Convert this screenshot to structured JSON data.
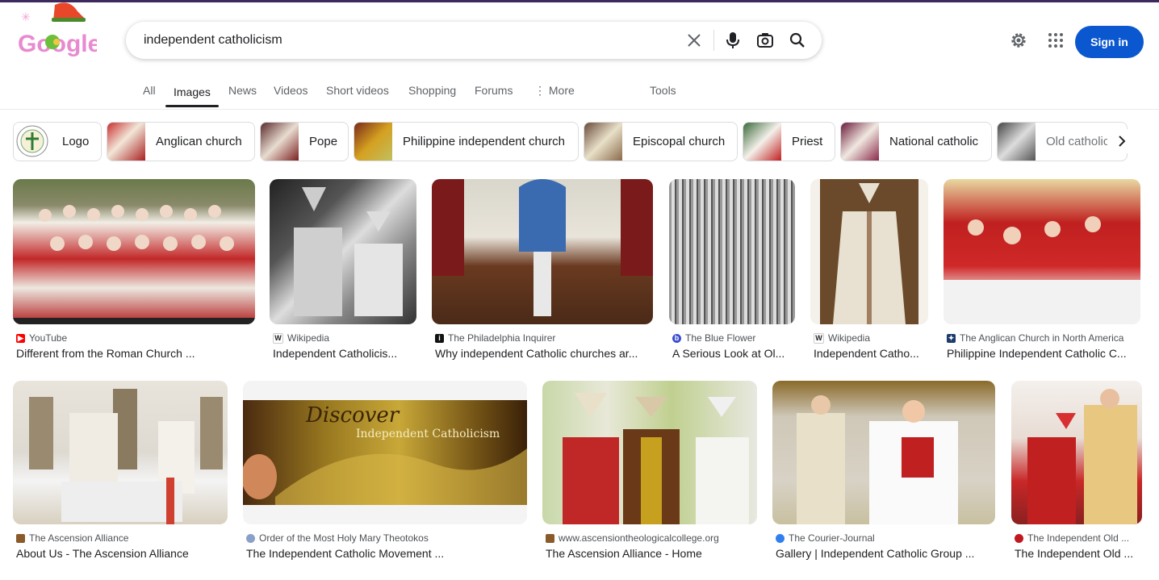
{
  "logo": {
    "text": "Google"
  },
  "search": {
    "query": "independent catholicism"
  },
  "header": {
    "signin_label": "Sign in"
  },
  "tabs": [
    {
      "label": "All"
    },
    {
      "label": "Images"
    },
    {
      "label": "News"
    },
    {
      "label": "Videos"
    },
    {
      "label": "Short videos"
    },
    {
      "label": "Shopping"
    },
    {
      "label": "Forums"
    },
    {
      "label": "More"
    }
  ],
  "tools_label": "Tools",
  "chips": [
    {
      "label": "Logo"
    },
    {
      "label": "Anglican church"
    },
    {
      "label": "Pope"
    },
    {
      "label": "Philippine independent church"
    },
    {
      "label": "Episcopal church"
    },
    {
      "label": "Priest"
    },
    {
      "label": "National catholic"
    },
    {
      "label": "Old catholic"
    }
  ],
  "results": [
    {
      "source": "YouTube",
      "title": "Different from the Roman Church ...",
      "fav_color": "#ff0000",
      "fav_text": "▶"
    },
    {
      "source": "Wikipedia",
      "title": "Independent Catholicis...",
      "fav_color": "#ffffff",
      "fav_text": "W"
    },
    {
      "source": "The Philadelphia Inquirer",
      "title": "Why independent Catholic churches ar...",
      "fav_color": "#111111",
      "fav_text": "i"
    },
    {
      "source": "The Blue Flower",
      "title": "A Serious Look at Ol...",
      "fav_color": "#3b4cd1",
      "fav_text": "b"
    },
    {
      "source": "Wikipedia",
      "title": "Independent Catho...",
      "fav_color": "#ffffff",
      "fav_text": "W"
    },
    {
      "source": "The Anglican Church in North America",
      "title": "Philippine Independent Catholic C...",
      "fav_color": "#1d3b6b",
      "fav_text": "✦"
    },
    {
      "source": "The Ascension Alliance",
      "title": "About Us - The Ascension Alliance",
      "fav_color": "#8a5a2b",
      "fav_text": ""
    },
    {
      "source": "Order of the Most Holy Mary Theotokos",
      "title": "The Independent Catholic Movement ...",
      "fav_color": "#8aa0c8",
      "fav_text": ""
    },
    {
      "source": "www.ascensiontheologicalcollege.org",
      "title": "The Ascension Alliance - Home",
      "fav_color": "#8a5a2b",
      "fav_text": ""
    },
    {
      "source": "The Courier-Journal",
      "title": "Gallery | Independent Catholic Group ...",
      "fav_color": "#2f80ed",
      "fav_text": ""
    },
    {
      "source": "The Independent Old ...",
      "title": "The Independent Old ...",
      "fav_color": "#c0181e",
      "fav_text": ""
    }
  ],
  "overlay_text": {
    "discover": "Discover",
    "independent_catholicism": "Independent Catholicism"
  }
}
